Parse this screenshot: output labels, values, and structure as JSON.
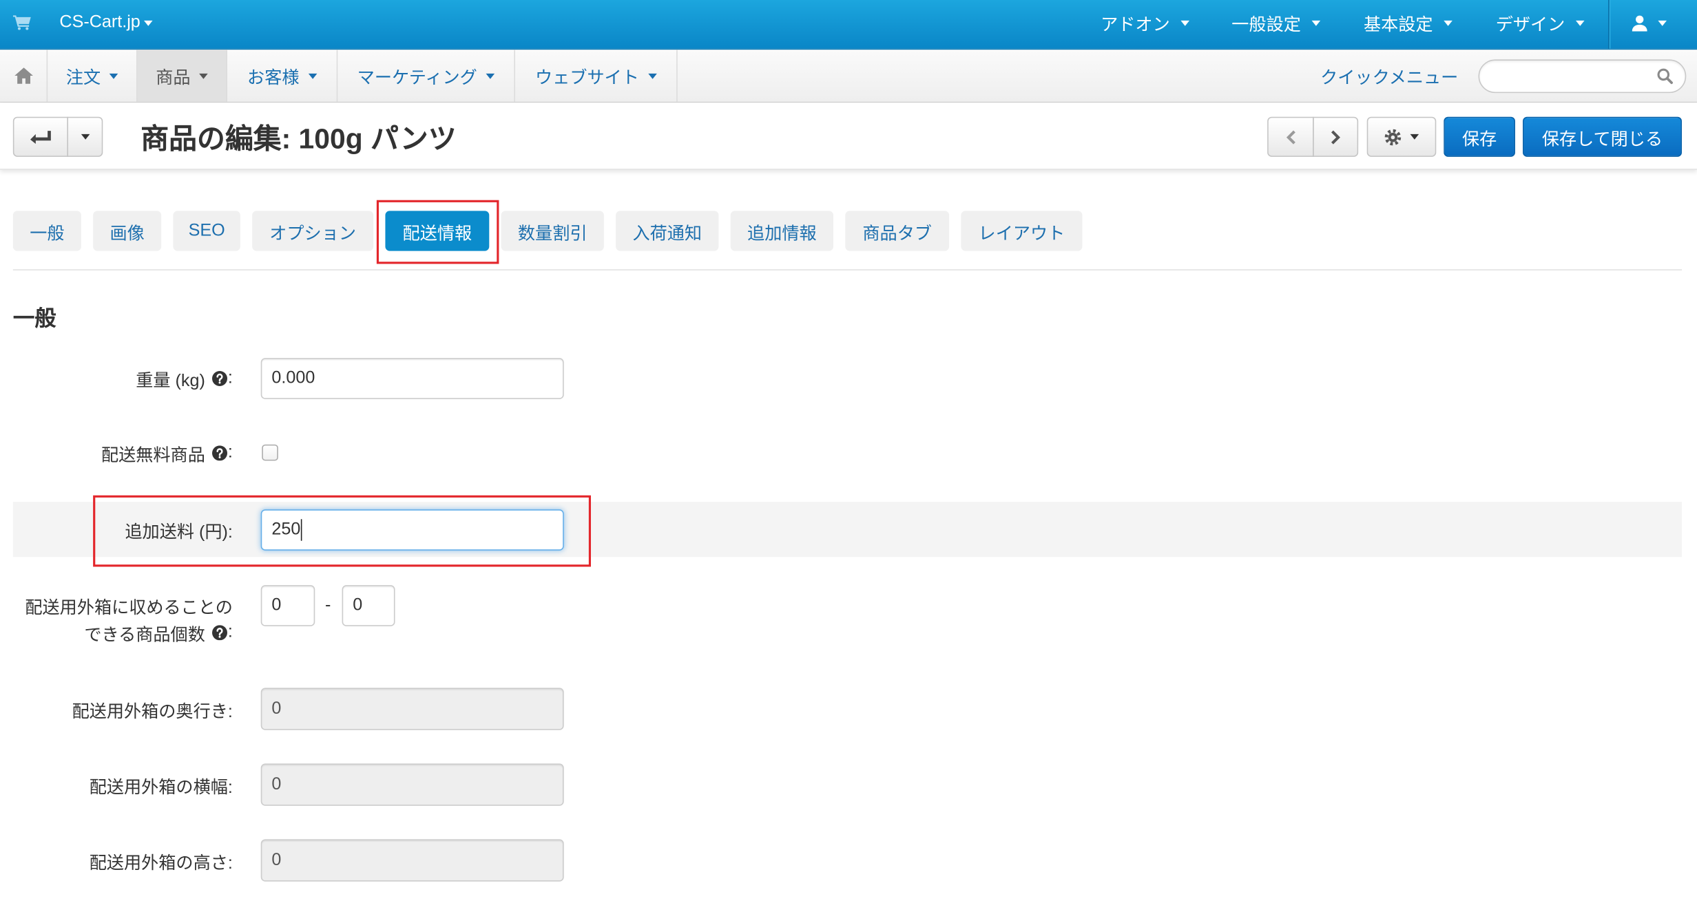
{
  "topbar": {
    "brand": "CS-Cart.jp",
    "menus": [
      {
        "label": "アドオン"
      },
      {
        "label": "一般設定"
      },
      {
        "label": "基本設定"
      },
      {
        "label": "デザイン"
      }
    ]
  },
  "navbar": {
    "items": [
      {
        "label": "注文"
      },
      {
        "label": "商品",
        "active": true
      },
      {
        "label": "お客様"
      },
      {
        "label": "マーケティング"
      },
      {
        "label": "ウェブサイト"
      }
    ],
    "quick_menu": "クイックメニュー"
  },
  "toolbar": {
    "title": "商品の編集: 100g パンツ",
    "save_label": "保存",
    "save_close_label": "保存して閉じる"
  },
  "tabs": {
    "items": [
      {
        "label": "一般"
      },
      {
        "label": "画像"
      },
      {
        "label": "SEO"
      },
      {
        "label": "オプション"
      },
      {
        "label": "配送情報",
        "active": true
      },
      {
        "label": "数量割引"
      },
      {
        "label": "入荷通知"
      },
      {
        "label": "追加情報"
      },
      {
        "label": "商品タブ"
      },
      {
        "label": "レイアウト"
      }
    ]
  },
  "section": {
    "title": "一般"
  },
  "form": {
    "colon": ":",
    "weight": {
      "label": "重量 (kg)",
      "value": "0.000"
    },
    "free_shipping": {
      "label": "配送無料商品",
      "checked": false
    },
    "shipping_freight": {
      "label": "追加送料 (円):",
      "value": "250"
    },
    "box_items": {
      "label_lines": [
        "配送用外箱に収めることの",
        "できる商品個数"
      ],
      "min": "0",
      "separator": "-",
      "max": "0"
    },
    "box_length": {
      "label": "配送用外箱の奥行き:",
      "value": "0",
      "disabled": true
    },
    "box_width": {
      "label": "配送用外箱の横幅:",
      "value": "0",
      "disabled": true
    },
    "box_height": {
      "label": "配送用外箱の高さ:",
      "value": "0",
      "disabled": true
    }
  },
  "icons": [
    "cart-icon",
    "user-icon",
    "home-icon",
    "search-icon",
    "back-arrow-icon",
    "chevron-left-icon",
    "chevron-right-icon",
    "gear-icon",
    "help-icon",
    "caret-down-icon"
  ],
  "colors": {
    "topbar": "#0d92d2",
    "link": "#1a6fb0",
    "active_tab": "#0b8ccc",
    "primary_button": "#0a6cc0",
    "annotation_box": "#e3262b"
  }
}
